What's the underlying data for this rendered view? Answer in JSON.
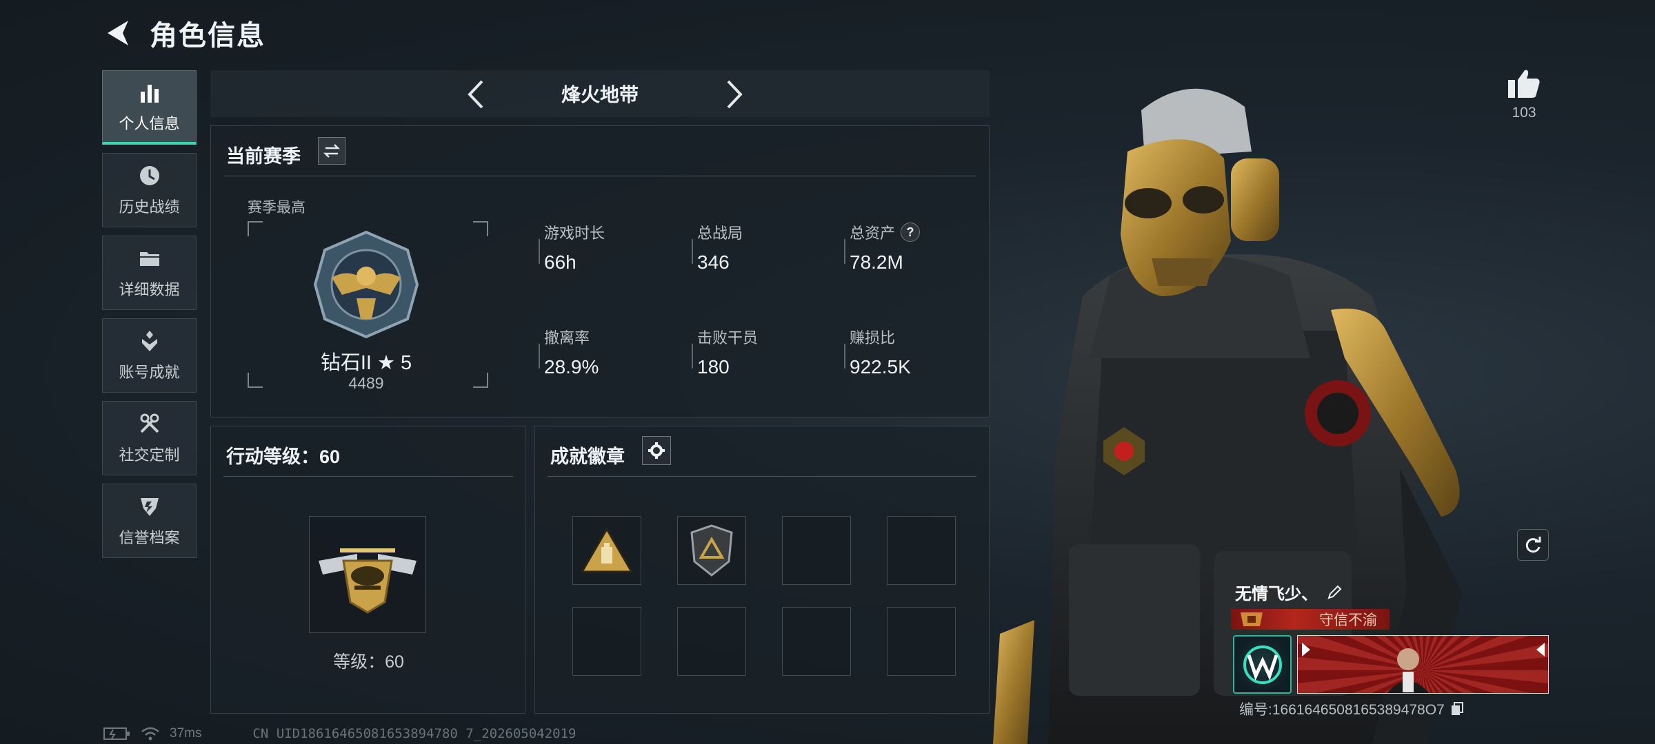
{
  "header": {
    "title": "角色信息"
  },
  "sidebar": {
    "items": [
      {
        "label": "个人信息",
        "icon": "bar-chart-icon",
        "active": true
      },
      {
        "label": "历史战绩",
        "icon": "clock-icon",
        "active": false
      },
      {
        "label": "详细数据",
        "icon": "folder-icon",
        "active": false
      },
      {
        "label": "账号成就",
        "icon": "medal-icon",
        "active": false
      },
      {
        "label": "社交定制",
        "icon": "tools-icon",
        "active": false
      },
      {
        "label": "信誉档案",
        "icon": "shield-icon",
        "active": false
      }
    ]
  },
  "mode": {
    "title": "烽火地带"
  },
  "season": {
    "title": "当前赛季",
    "best_label": "赛季最高",
    "rank_name": "钻石II ★ 5",
    "rank_score": "4489",
    "stats": [
      {
        "label": "游戏时长",
        "value": "66h"
      },
      {
        "label": "总战局",
        "value": "346"
      },
      {
        "label": "总资产",
        "value": "78.2M",
        "help": "?"
      },
      {
        "label": "撤离率",
        "value": "28.9%"
      },
      {
        "label": "击败干员",
        "value": "180"
      },
      {
        "label": "赚损比",
        "value": "922.5K"
      }
    ]
  },
  "action_level": {
    "title": "行动等级：60",
    "caption": "等级：60"
  },
  "badges": {
    "title": "成就徽章",
    "slots": 8,
    "filled": 2
  },
  "likes": {
    "count": "103"
  },
  "player": {
    "name": "无情飞少、",
    "honor_title": "守信不渝",
    "id_text": "编号:1661646508165389478O7"
  },
  "status": {
    "ping": "37ms",
    "uid": "CN UID18616465081653894780 7_202605042019"
  },
  "colors": {
    "accent": "#3fd4b0",
    "gold": "#c9a24a",
    "banner_red": "#b3261c"
  }
}
